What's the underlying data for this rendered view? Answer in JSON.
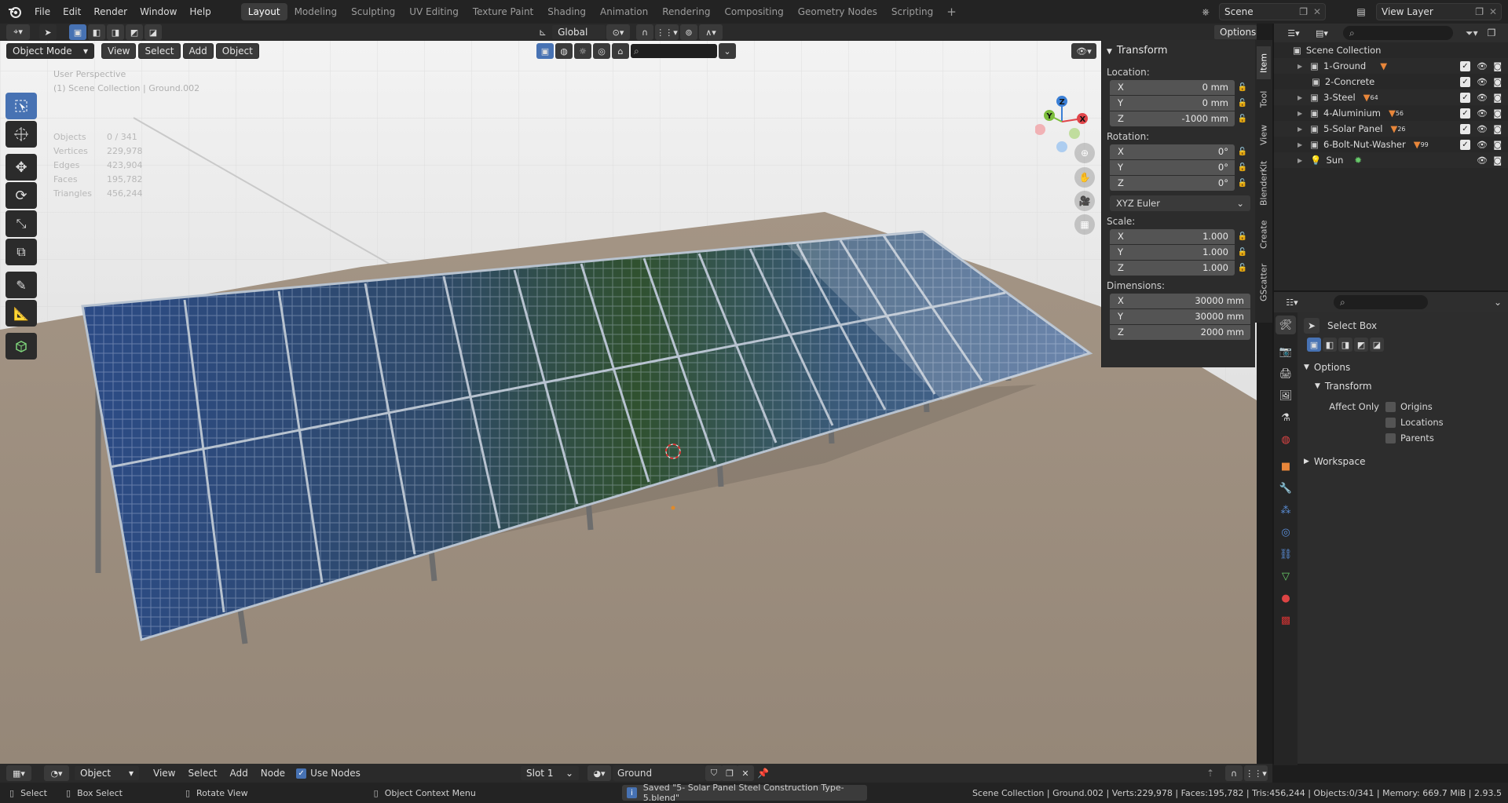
{
  "menu": {
    "items": [
      "File",
      "Edit",
      "Render",
      "Window",
      "Help"
    ]
  },
  "workspaces": {
    "tabs": [
      "Layout",
      "Modeling",
      "Sculpting",
      "UV Editing",
      "Texture Paint",
      "Shading",
      "Animation",
      "Rendering",
      "Compositing",
      "Geometry Nodes",
      "Scripting"
    ],
    "active": "Layout",
    "add": "+"
  },
  "scene": {
    "name": "Scene",
    "view_layer": "View Layer"
  },
  "viewport": {
    "transform_orientation": "Global",
    "options_label": "Options",
    "mode": "Object Mode",
    "menus": [
      "View",
      "Select",
      "Add",
      "Object"
    ],
    "view_name": "User Perspective",
    "context": "(1) Scene Collection | Ground.002",
    "stats": [
      {
        "label": "Objects",
        "value": "0 / 341"
      },
      {
        "label": "Vertices",
        "value": "229,978"
      },
      {
        "label": "Edges",
        "value": "423,904"
      },
      {
        "label": "Faces",
        "value": "195,782"
      },
      {
        "label": "Triangles",
        "value": "456,244"
      }
    ],
    "gizmo": {
      "x": "X",
      "y": "Y",
      "z": "Z"
    }
  },
  "npanel": {
    "tabs": [
      "Item",
      "Tool",
      "View",
      "BlenderKit",
      "Create",
      "GScatter"
    ],
    "active_tab": "Item",
    "title": "Transform",
    "location_label": "Location:",
    "location": [
      {
        "axis": "X",
        "value": "0 mm"
      },
      {
        "axis": "Y",
        "value": "0 mm"
      },
      {
        "axis": "Z",
        "value": "-1000 mm"
      }
    ],
    "rotation_label": "Rotation:",
    "rotation": [
      {
        "axis": "X",
        "value": "0°"
      },
      {
        "axis": "Y",
        "value": "0°"
      },
      {
        "axis": "Z",
        "value": "0°"
      }
    ],
    "rotation_mode": "XYZ Euler",
    "scale_label": "Scale:",
    "scale": [
      {
        "axis": "X",
        "value": "1.000"
      },
      {
        "axis": "Y",
        "value": "1.000"
      },
      {
        "axis": "Z",
        "value": "1.000"
      }
    ],
    "dimensions_label": "Dimensions:",
    "dimensions": [
      {
        "axis": "X",
        "value": "30000 mm"
      },
      {
        "axis": "Y",
        "value": "30000 mm"
      },
      {
        "axis": "Z",
        "value": "2000 mm"
      }
    ]
  },
  "outliner": {
    "root": "Scene Collection",
    "items": [
      {
        "name": "1-Ground",
        "badge": ""
      },
      {
        "name": "2-Concrete",
        "badge": ""
      },
      {
        "name": "3-Steel",
        "badge": "64"
      },
      {
        "name": "4-Aluminium",
        "badge": "56"
      },
      {
        "name": "5-Solar Panel",
        "badge": "26"
      },
      {
        "name": "6-Bolt-Nut-Washer",
        "badge": "99"
      },
      {
        "name": "Sun",
        "badge": ""
      }
    ]
  },
  "properties": {
    "tool_name": "Select Box",
    "options_label": "Options",
    "transform_label": "Transform",
    "affect_only_label": "Affect Only",
    "affect_only": [
      "Origins",
      "Locations",
      "Parents"
    ],
    "workspace_label": "Workspace"
  },
  "shader_header": {
    "object_label": "Object",
    "menus": [
      "View",
      "Select",
      "Add",
      "Node"
    ],
    "use_nodes": "Use Nodes",
    "slot": "Slot 1",
    "material": "Ground"
  },
  "statusbar": {
    "select": "Select",
    "box_select": "Box Select",
    "rotate_view": "Rotate View",
    "context_menu": "Object Context Menu",
    "message": "Saved \"5- Solar Panel Steel Construction Type-5.blend\"",
    "stats": "Scene Collection | Ground.002 | Verts:229,978 | Faces:195,782 | Tris:456,244 | Objects:0/341 | Memory: 669.7 MiB | 2.93.5"
  },
  "colors": {
    "accent": "#4772b3",
    "panel_bg": "#2c2c2c",
    "header_bg": "#232323"
  }
}
